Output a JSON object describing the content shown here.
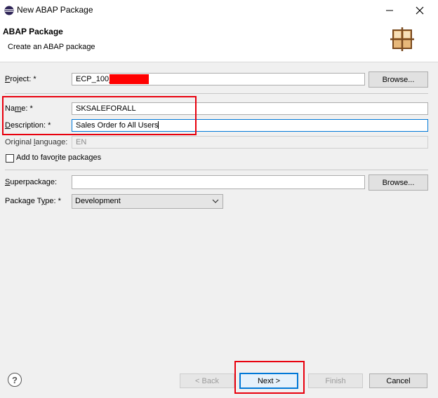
{
  "window": {
    "title": "New ABAP Package"
  },
  "header": {
    "title": "ABAP Package",
    "subtitle": "Create an ABAP package"
  },
  "form": {
    "project": {
      "label": "Project: *",
      "value": "ECP_100_",
      "browse_label": "Browse..."
    },
    "name": {
      "label": "Name: *",
      "value": "SKSALEFORALL"
    },
    "description": {
      "label": "Description: *",
      "value": "Sales Order fo All Users"
    },
    "original_language": {
      "label": "Original language:",
      "value": "EN"
    },
    "favorite": {
      "label": "Add to favorite packages",
      "checked": false
    },
    "superpackage": {
      "label": "Superpackage:",
      "value": "",
      "browse_label": "Browse..."
    },
    "package_type": {
      "label": "Package Type: *",
      "value": "Development"
    }
  },
  "footer": {
    "back_label": "< Back",
    "next_label": "Next >",
    "finish_label": "Finish",
    "cancel_label": "Cancel"
  },
  "colors": {
    "highlight": "#e8000d",
    "focus": "#0078d7",
    "redacted": "#ff0000"
  }
}
